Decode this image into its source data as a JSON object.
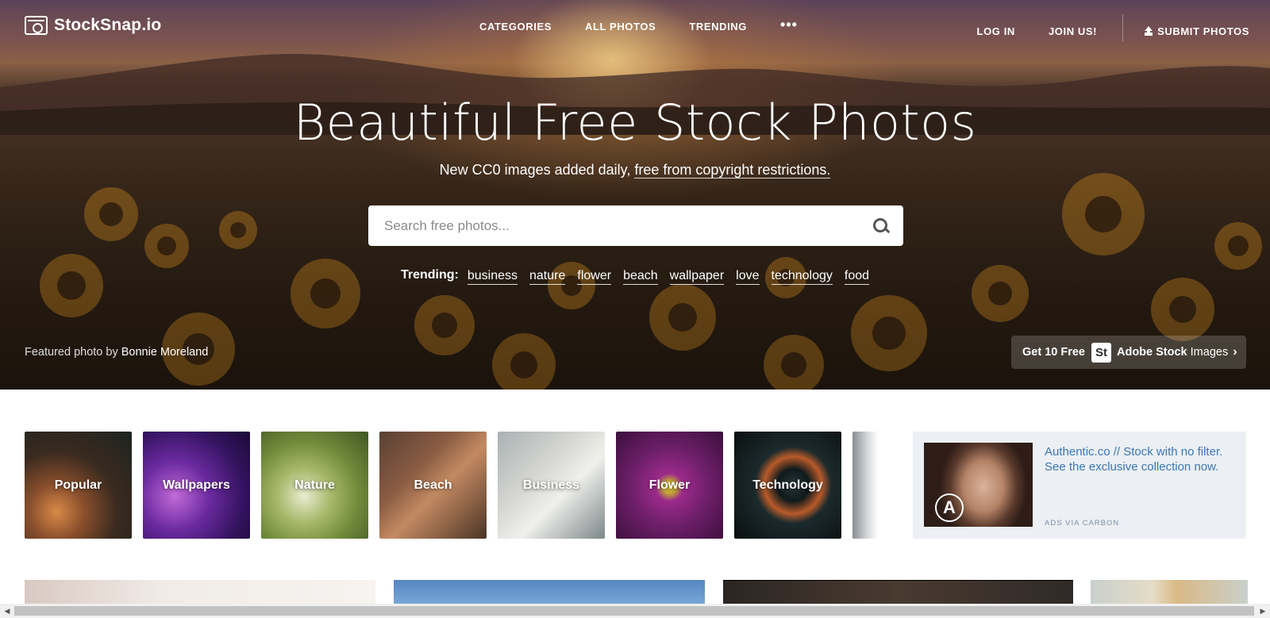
{
  "nav": {
    "logo_text": "StockSnap.io",
    "links": [
      "CATEGORIES",
      "ALL PHOTOS",
      "TRENDING"
    ],
    "more_label": "•••",
    "login": "LOG IN",
    "join": "JOIN US!",
    "submit": "SUBMIT PHOTOS"
  },
  "hero": {
    "title": "Beautiful Free Stock Photos",
    "subtitle_prefix": "New CC0 images added daily, ",
    "subtitle_link": "free from copyright restrictions.",
    "search_placeholder": "Search free photos...",
    "trending_label": "Trending:",
    "trending_tags": [
      "business",
      "nature",
      "flower",
      "beach",
      "wallpaper",
      "love",
      "technology",
      "food"
    ],
    "featured_prefix": "Featured photo by ",
    "featured_author": "Bonnie Moreland",
    "adobe_prefix": "Get 10 Free",
    "adobe_badge": "St",
    "adobe_brand": "Adobe Stock",
    "adobe_suffix": "Images",
    "adobe_chevron": "›"
  },
  "categories": [
    "Popular",
    "Wallpapers",
    "Nature",
    "Beach",
    "Business",
    "Flower",
    "Technology"
  ],
  "carbon": {
    "text": "Authentic.co // Stock with no filter. See the exclusive collection now.",
    "via": "ADS VIA CARBON",
    "logo_letter": "A"
  },
  "scrollbar": {
    "left_arrow": "◀",
    "right_arrow": "▶"
  },
  "colors": {
    "link_blue": "#3a77b6",
    "carbon_bg": "#eceff3"
  }
}
